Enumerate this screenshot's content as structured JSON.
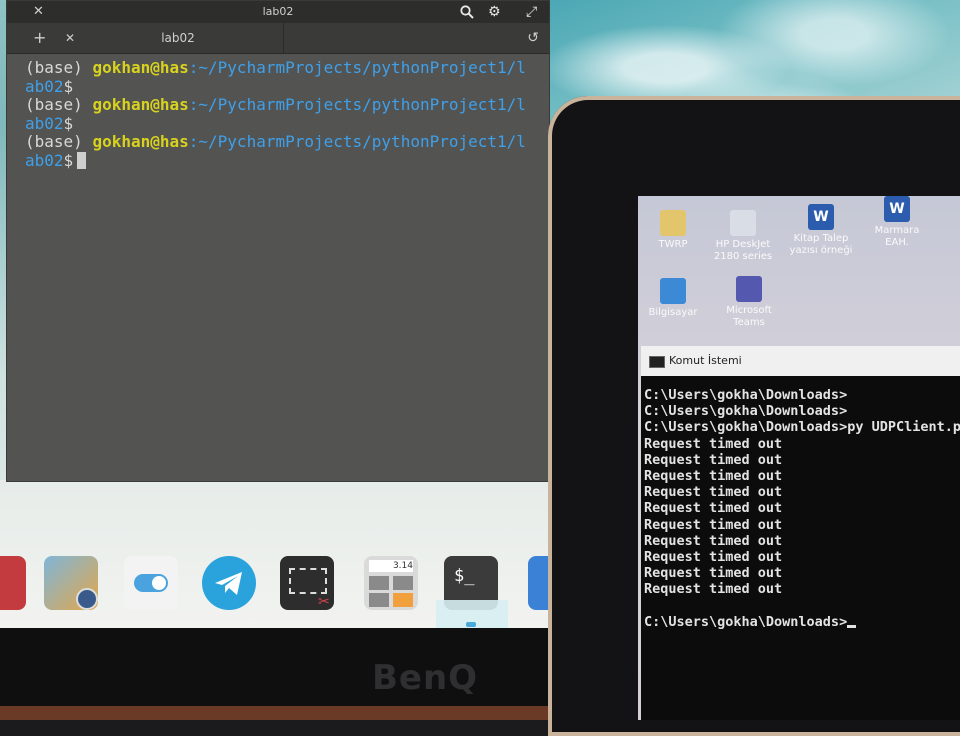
{
  "terminal": {
    "window_title": "lab02",
    "tab_label": "lab02",
    "lines": [
      {
        "env": "(base)",
        "user": "gokhan@has",
        "path": ":~/PycharmProjects/pythonProject1/l",
        "cont": "ab02",
        "prompt": "$"
      },
      {
        "env": "(base)",
        "user": "gokhan@has",
        "path": ":~/PycharmProjects/pythonProject1/l",
        "cont": "ab02",
        "prompt": "$"
      },
      {
        "env": "(base)",
        "user": "gokhan@has",
        "path": ":~/PycharmProjects/pythonProject1/l",
        "cont": "ab02",
        "prompt": "$"
      }
    ]
  },
  "dock": {
    "apps": [
      {
        "name": "app-partial",
        "color": "#c43b3f"
      },
      {
        "name": "photo-viewer",
        "color": "#e3a64a"
      },
      {
        "name": "settings-toggle",
        "color": "#f3f3f3"
      },
      {
        "name": "telegram",
        "color": "#2aa3dc"
      },
      {
        "name": "screenshot",
        "color": "#2d2d2d"
      },
      {
        "name": "calculator",
        "color": "#dadada"
      },
      {
        "name": "terminal",
        "color": "#3b3b3b"
      },
      {
        "name": "app-partial-right",
        "color": "#3b82d6"
      }
    ],
    "calculator_display": "3.14",
    "terminal_glyph": "$_"
  },
  "monitor": {
    "brand": "BenQ"
  },
  "tablet": {
    "desktop_icons": [
      {
        "label": "TWRP",
        "color": "#e3c66b"
      },
      {
        "label": "HP DeskJet 2180 series",
        "color": "#d9dde6"
      },
      {
        "label": "Kitap Talep yazısı örneği",
        "color": "#2b5cad"
      },
      {
        "label": "Marmara EAH.",
        "color": "#2b5cad"
      },
      {
        "label": "Bilgisayar",
        "color": "#3c8ad6"
      },
      {
        "label": "Microsoft Teams",
        "color": "#5558af"
      }
    ],
    "cmd": {
      "title": "Komut İstemi",
      "lines": [
        "C:\\Users\\gokha\\Downloads>",
        "C:\\Users\\gokha\\Downloads>",
        "C:\\Users\\gokha\\Downloads>py UDPClient.py",
        "Request timed out",
        "Request timed out",
        "Request timed out",
        "Request timed out",
        "Request timed out",
        "Request timed out",
        "Request timed out",
        "Request timed out",
        "Request timed out",
        "Request timed out",
        "",
        "C:\\Users\\gokha\\Downloads>"
      ]
    }
  }
}
